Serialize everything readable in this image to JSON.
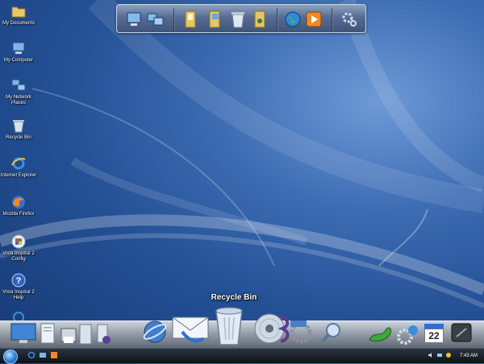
{
  "desktop": {
    "icons": [
      {
        "label": "My Documents",
        "icon": "folder-icon"
      },
      {
        "label": "My Computer",
        "icon": "computer-icon"
      },
      {
        "label": "My Network Places",
        "icon": "network-icon"
      },
      {
        "label": "Recycle Bin",
        "icon": "recycle-bin-icon"
      },
      {
        "label": "Internet Explorer",
        "icon": "internet-explorer-icon"
      },
      {
        "label": "Mozilla Firefox",
        "icon": "firefox-icon"
      },
      {
        "label": "Vista Inspirat 2 Config",
        "icon": "vista-config-icon"
      },
      {
        "label": "Vista Inspirat 2 Help",
        "icon": "help-icon"
      }
    ]
  },
  "top_dock": {
    "items": [
      "computer-icon",
      "network-icon",
      "documents-folder-icon",
      "pictures-folder-icon",
      "recycle-bin-icon",
      "music-folder-icon",
      "globe-icon",
      "media-player-icon",
      "settings-gear-icon"
    ]
  },
  "bottom_dock": {
    "hover_label": "Recycle Bin",
    "items": [
      "desktop-icon",
      "documents-icon",
      "printer-icon",
      "folder-icon",
      "network-icon",
      "internet-explorer-icon",
      "mail-icon",
      "recycle-bin-icon",
      "media-disc-icon",
      "music-icon",
      "settings-icon",
      "search-icon",
      "lizard-icon",
      "system-settings-icon",
      "calendar-icon",
      "shutdown-icon"
    ],
    "calendar_day": "22"
  },
  "taskbar": {
    "clock": "7:43 AM",
    "quick_launch": [
      "internet-explorer-icon",
      "show-desktop-icon",
      "media-player-icon"
    ],
    "tray": [
      "volume-icon",
      "network-tray-icon",
      "security-icon"
    ]
  },
  "colors": {
    "wallpaper": "#234f94",
    "taskbar": "#0e1218"
  }
}
